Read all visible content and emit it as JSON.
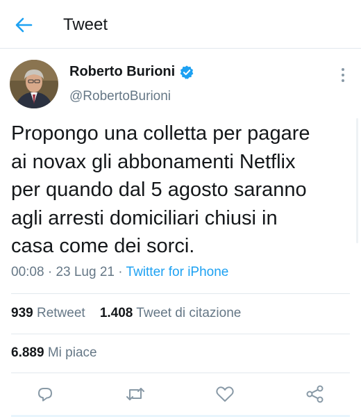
{
  "header": {
    "title": "Tweet"
  },
  "author": {
    "name": "Roberto Burioni",
    "handle": "@RobertoBurioni"
  },
  "tweet": {
    "text": "Propongo una colletta per pagare\nai novax gli abbonamenti Netflix\nper quando dal 5 agosto saranno\nagli arresti domiciliari chiusi in\ncasa come dei sorci.",
    "time": "00:08",
    "date": "23 Lug 21",
    "separator": "·",
    "source": "Twitter for iPhone"
  },
  "stats": {
    "retweets_count": "939",
    "retweets_label": "Retweet",
    "quotes_count": "1.408",
    "quotes_label": "Tweet di citazione",
    "likes_count": "6.889",
    "likes_label": "Mi piace"
  },
  "icons": {
    "back": "arrow-left-icon",
    "verified": "verified-badge-icon",
    "more": "more-vertical-icon",
    "reply": "reply-icon",
    "retweet": "retweet-icon",
    "like": "heart-icon",
    "share": "share-icon"
  },
  "colors": {
    "accent": "#1da1f2",
    "text": "#14171a",
    "secondary": "#657786",
    "icon": "#8899a6"
  }
}
